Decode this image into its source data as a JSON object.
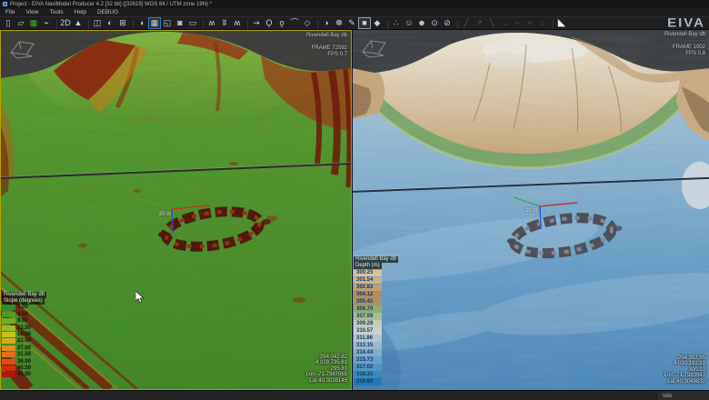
{
  "window": {
    "title": "Project - EIVA NaviModel Producer 4.2  [32 bit] ([32619] WGS 84 / UTM zone 19N) *"
  },
  "menu": {
    "items": [
      {
        "name": "menu-file",
        "label": "File"
      },
      {
        "name": "menu-view",
        "label": "View"
      },
      {
        "name": "menu-tools",
        "label": "Tools"
      },
      {
        "name": "menu-help",
        "label": "Help"
      },
      {
        "name": "menu-debug",
        "label": "DEBUG"
      }
    ]
  },
  "toolbar": {
    "icons": [
      {
        "name": "new-file-icon",
        "glyph": "▯"
      },
      {
        "name": "open-folder-icon",
        "glyph": "▱"
      },
      {
        "name": "save-icon",
        "glyph": "▦",
        "color": "#45b02e"
      },
      {
        "name": "connect-plug-icon",
        "glyph": "⌁"
      },
      {
        "name": "view-2d-icon",
        "glyph": "2D",
        "state": "gap"
      },
      {
        "name": "pointer-icon",
        "glyph": "▲"
      },
      {
        "name": "cube-3d-icon",
        "glyph": "◫",
        "state": "gap"
      },
      {
        "name": "globe-icon",
        "glyph": "◐"
      },
      {
        "name": "grid-icon",
        "glyph": "⊞"
      },
      {
        "name": "lasso-icon",
        "glyph": "◖",
        "state": "gap"
      },
      {
        "name": "table-view-icon",
        "glyph": "▦",
        "state": "active"
      },
      {
        "name": "frame-view-icon",
        "glyph": "◱"
      },
      {
        "name": "camera-icon",
        "glyph": "◙"
      },
      {
        "name": "ruler-icon",
        "glyph": "▭"
      },
      {
        "name": "profile-wave-icon",
        "glyph": "ʍ",
        "state": "gap"
      },
      {
        "name": "profile-peaks-icon",
        "glyph": "ʬ"
      },
      {
        "name": "profile-dip-icon",
        "glyph": "ʍ"
      },
      {
        "name": "route-icon",
        "glyph": "⇝",
        "state": "gap"
      },
      {
        "name": "pin-icon",
        "glyph": "Ϙ"
      },
      {
        "name": "pin-alt-icon",
        "glyph": "ϙ"
      },
      {
        "name": "arc-icon",
        "glyph": "⌒"
      },
      {
        "name": "polygon-icon",
        "glyph": "◇"
      },
      {
        "name": "shaded-sphere-icon",
        "glyph": "◑",
        "state": "gap"
      },
      {
        "name": "palette-icon",
        "glyph": "☸"
      },
      {
        "name": "draw-hand-icon",
        "glyph": "✎"
      },
      {
        "name": "fill-square-icon",
        "glyph": "■",
        "state": "selected"
      },
      {
        "name": "tag-icon",
        "glyph": "◆"
      },
      {
        "name": "scatter-points-icon",
        "glyph": "∴",
        "state": "gap"
      },
      {
        "name": "smiley-icon",
        "glyph": "☺"
      },
      {
        "name": "smiley-dark-icon",
        "glyph": "☻"
      },
      {
        "name": "node-add-icon",
        "glyph": "⊙"
      },
      {
        "name": "node-remove-icon",
        "glyph": "⊘"
      },
      {
        "name": "line-tool-icon",
        "glyph": "╱",
        "state": "disabled gap"
      },
      {
        "name": "line-arrow-icon",
        "glyph": "↗",
        "state": "disabled"
      },
      {
        "name": "line-back-icon",
        "glyph": "╲",
        "state": "disabled"
      },
      {
        "name": "line-extend-icon",
        "glyph": "→",
        "state": "disabled"
      },
      {
        "name": "line-flat-icon",
        "glyph": "−",
        "state": "disabled"
      },
      {
        "name": "line-smooth-icon",
        "glyph": "≈",
        "state": "disabled"
      },
      {
        "name": "circle-tool-icon",
        "glyph": "○",
        "state": "disabled"
      },
      {
        "name": "slope-profile-icon",
        "glyph": "◣",
        "state": "light gap"
      }
    ]
  },
  "brand": {
    "logo": "EIVA"
  },
  "views": {
    "left": {
      "hud": {
        "title": "Rivendell Bay db",
        "meta": "···········",
        "frame": "FRAME 72592",
        "fps": "FPS 0.7"
      },
      "legend": {
        "title": "Rivendell Bay db",
        "subtitle": "Slope (degrees)",
        "entries": [
          {
            "value": "0.00",
            "color": "#2e8f29"
          },
          {
            "value": "4.50",
            "color": "#4d9c27"
          },
          {
            "value": "9.00",
            "color": "#74ab25"
          },
          {
            "value": "13.50",
            "color": "#9dba23"
          },
          {
            "value": "18.00",
            "color": "#c4c321"
          },
          {
            "value": "22.50",
            "color": "#d4ad1f"
          },
          {
            "value": "27.00",
            "color": "#dd901d"
          },
          {
            "value": "31.50",
            "color": "#e2701a"
          },
          {
            "value": "36.00",
            "color": "#e04f16"
          },
          {
            "value": "40.50",
            "color": "#cc2e11"
          },
          {
            "value": "45.00",
            "color": "#ab180c"
          }
        ]
      },
      "coords": [
        "294 042.82",
        "4 028 735.81",
        "295.81",
        "Lon -71.7987065",
        "Lat 40.3038145"
      ],
      "scale_label": "20 m"
    },
    "right": {
      "hud": {
        "title": "Rivendell Bay db",
        "meta": "···········",
        "frame": "FRAME 1002",
        "fps": "FPS 0.8"
      },
      "legend": {
        "title": "Rivendell Bay db",
        "subtitle": "Depth (m)",
        "entries": [
          {
            "value": "300.25",
            "color": "#d8c499"
          },
          {
            "value": "301.54",
            "color": "#cfb386"
          },
          {
            "value": "302.83",
            "color": "#c2a06f"
          },
          {
            "value": "304.12",
            "color": "#b48d5b"
          },
          {
            "value": "305.41",
            "color": "#a6926b"
          },
          {
            "value": "306.70",
            "color": "#8fae72"
          },
          {
            "value": "307.99",
            "color": "#a6bd8d"
          },
          {
            "value": "309.28",
            "color": "#c3ccb6"
          },
          {
            "value": "310.57",
            "color": "#c8d1d4"
          },
          {
            "value": "311.86",
            "color": "#b0c6d4"
          },
          {
            "value": "313.15",
            "color": "#98bacf"
          },
          {
            "value": "314.44",
            "color": "#80aecb"
          },
          {
            "value": "315.73",
            "color": "#68a2c6"
          },
          {
            "value": "317.02",
            "color": "#5095c1"
          },
          {
            "value": "318.31",
            "color": "#3889bb"
          },
          {
            "value": "319.60",
            "color": "#2179b1"
          }
        ]
      },
      "coords": [
        "294 992.85",
        "4 030 191.91",
        "300.19",
        "Lon -71.7983947",
        "Lat 40.3049830"
      ],
      "scale_label": "20 m"
    }
  },
  "status": {
    "label": "Idle"
  },
  "colors": {
    "active_viewport_border": "#b3a300",
    "toolbar_highlight": "#3a7abf",
    "brand_gray": "#b2b8bc"
  }
}
